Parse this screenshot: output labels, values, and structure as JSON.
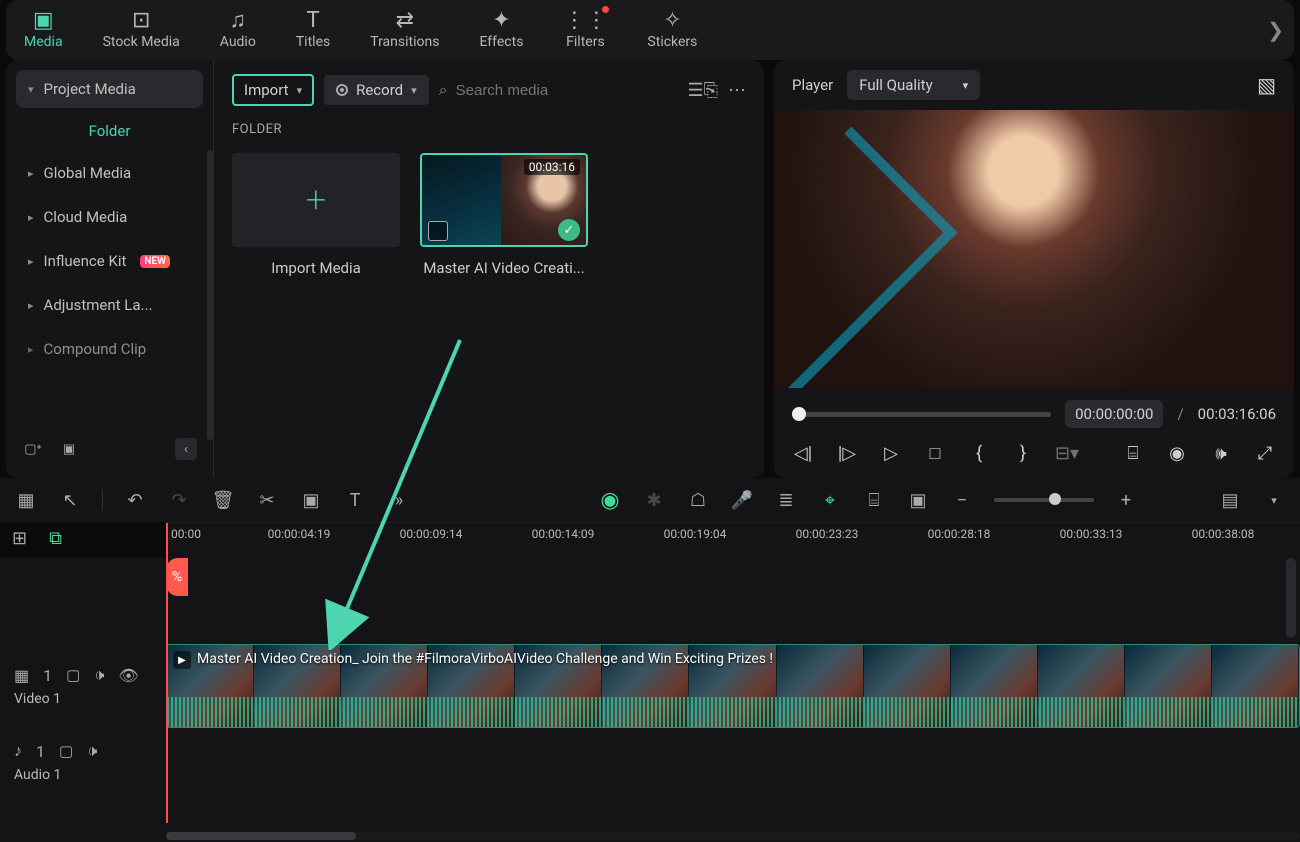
{
  "tabs": {
    "media": "Media",
    "stock": "Stock Media",
    "audio": "Audio",
    "titles": "Titles",
    "transitions": "Transitions",
    "effects": "Effects",
    "filters": "Filters",
    "stickers": "Stickers"
  },
  "sidebar": {
    "projectMedia": "Project Media",
    "folder": "Folder",
    "globalMedia": "Global Media",
    "cloudMedia": "Cloud Media",
    "influenceKit": "Influence Kit",
    "adjustmentLayer": "Adjustment La...",
    "compoundClip": "Compound Clip",
    "newBadge": "NEW"
  },
  "toolbar": {
    "import": "Import",
    "record": "Record",
    "searchPlaceholder": "Search media"
  },
  "folderSection": "FOLDER",
  "cards": {
    "import": "Import Media",
    "clip1": {
      "name": "Master AI Video Creati...",
      "duration": "00:03:16"
    }
  },
  "player": {
    "label": "Player",
    "quality": "Full Quality",
    "current": "00:00:00:00",
    "sep": "/",
    "total": "00:03:16:06"
  },
  "ruler": {
    "t0": "00:00",
    "t1": "00:00:04:19",
    "t2": "00:00:09:14",
    "t3": "00:00:14:09",
    "t4": "00:00:19:04",
    "t5": "00:00:23:23",
    "t6": "00:00:28:18",
    "t7": "00:00:33:13",
    "t8": "00:00:38:08"
  },
  "tracks": {
    "video1": "Video 1",
    "audio1": "Audio 1",
    "v1num": "1",
    "a1num": "1"
  },
  "clipTitle": "Master AI Video Creation_ Join the #FilmoraVirboAIVideo Challenge and Win Exciting Prizes !"
}
